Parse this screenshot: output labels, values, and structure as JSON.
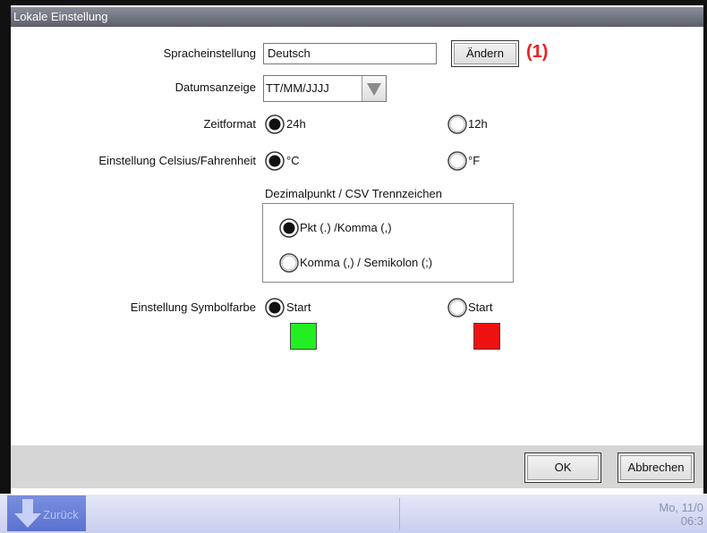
{
  "window": {
    "title": "Lokale Einstellung"
  },
  "language": {
    "label": "Spracheinstellung",
    "value": "Deutsch",
    "change_button": "Ändern",
    "callout": "(1)"
  },
  "date_display": {
    "label": "Datumsanzeige",
    "value": "TT/MM/JJJJ"
  },
  "time_format": {
    "label": "Zeitformat",
    "options": [
      "24h",
      "12h"
    ],
    "selected": "24h"
  },
  "temperature": {
    "label": "Einstellung Celsius/Fahrenheit",
    "options": [
      "°C",
      "°F"
    ],
    "selected": "°C"
  },
  "decimal": {
    "title": "Dezimalpunkt / CSV Trennzeichen",
    "options": [
      "Pkt (.) /Komma (,)",
      "Komma (,) / Semikolon (;)"
    ],
    "selected": "Pkt (.) /Komma (,)"
  },
  "symbol_color": {
    "label": "Einstellung Symbolfarbe",
    "options": [
      "Start",
      "Start"
    ],
    "selected_index": 0,
    "colors": [
      "#22ee22",
      "#ee1111"
    ]
  },
  "footer": {
    "ok": "OK",
    "cancel": "Abbrechen"
  },
  "taskbar": {
    "back": "Zurück",
    "date_line1": "Mo, 11/0",
    "date_line2": "06:3"
  },
  "icons": {
    "radio_selected": "radio-selected-icon",
    "radio_unselected": "radio-unselected-icon",
    "dropdown": "triangle-down-icon",
    "back": "arrow-down-icon"
  }
}
